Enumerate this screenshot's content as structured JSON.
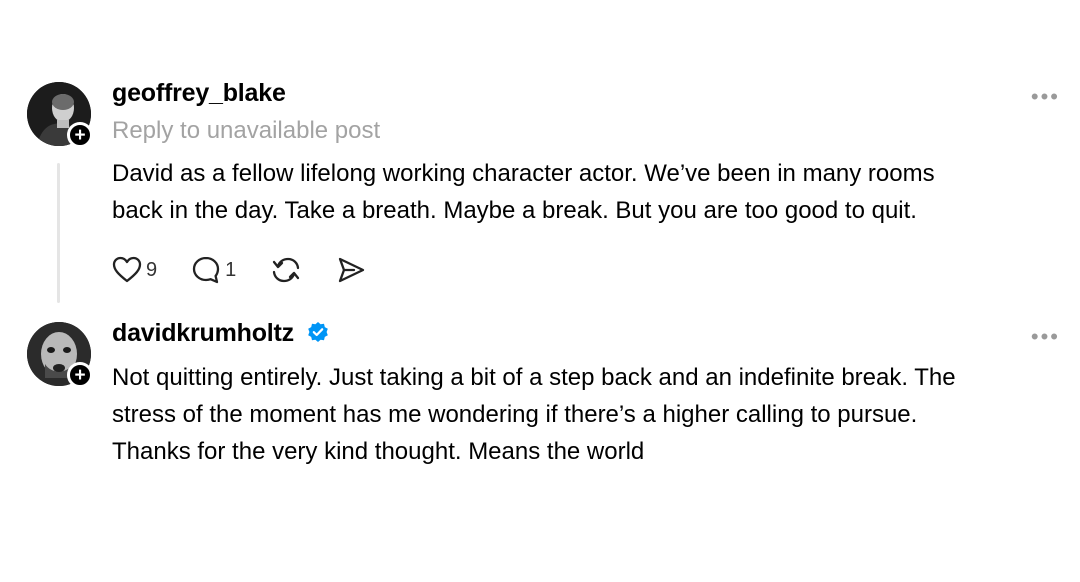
{
  "posts": [
    {
      "username": "geoffrey_blake",
      "reply_note": "Reply to unavailable post",
      "lines": [
        "David as a fellow lifelong working character actor. We’ve been in many rooms",
        "back in the day. Take a breath. Maybe a break. But you are too good to quit."
      ],
      "likes": "9",
      "replies": "1",
      "more_label": "•••",
      "follow_label": "+"
    },
    {
      "username": "davidkrumholtz",
      "verified": true,
      "lines": [
        "Not quitting entirely. Just taking a bit of a step back and an indefinite break. The",
        "stress of the moment has me wondering if there’s a higher calling to pursue.",
        "Thanks for the very kind thought. Means the world"
      ],
      "more_label": "•••",
      "follow_label": "+"
    }
  ],
  "colors": {
    "text": "#000000",
    "muted": "#a3a3a3",
    "verified": "#0095f6",
    "thread_line": "#e5e5e5"
  },
  "icons": [
    "heart-icon",
    "comment-icon",
    "repost-icon",
    "share-icon",
    "more-icon",
    "verified-badge-icon",
    "plus-icon"
  ]
}
